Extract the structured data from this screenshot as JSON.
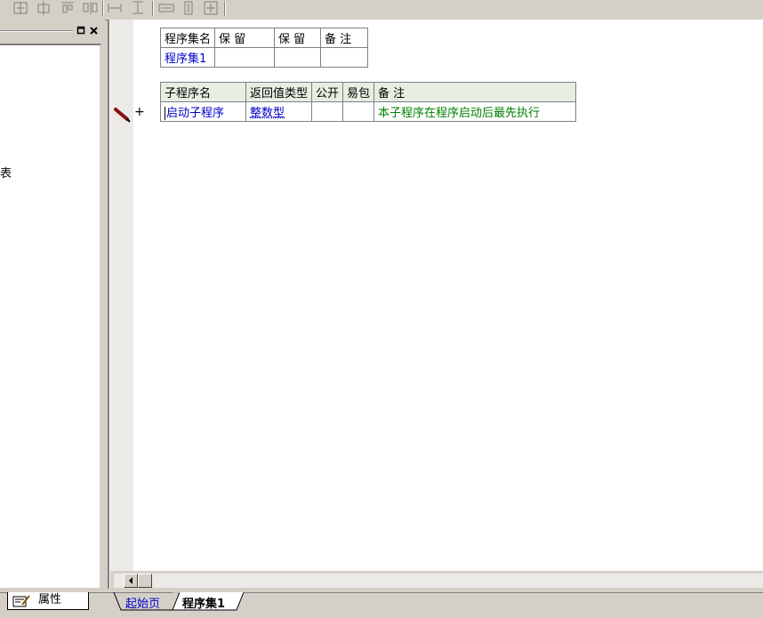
{
  "left_panel": {
    "clipped_text": "表"
  },
  "assembly_table": {
    "headers": [
      "程序集名",
      "保 留",
      "保 留",
      "备 注"
    ],
    "rows": [
      [
        "程序集1",
        "",
        "",
        ""
      ]
    ]
  },
  "subroutine_table": {
    "headers": [
      "子程序名",
      "返回值类型",
      "公开",
      "易包",
      "备 注"
    ],
    "rows": [
      [
        "启动子程序",
        "整数型",
        "",
        "",
        "本子程序在程序启动后最先执行"
      ]
    ]
  },
  "gutter": {
    "expand_symbol": "+"
  },
  "bottom_tabs": {
    "properties_label": "属性",
    "start_page": "起始页",
    "assembly_tab": "程序集1"
  },
  "colors": {
    "accent_blue": "#0000cc",
    "comment_green": "#008000",
    "header_green": "#e6efe1"
  }
}
